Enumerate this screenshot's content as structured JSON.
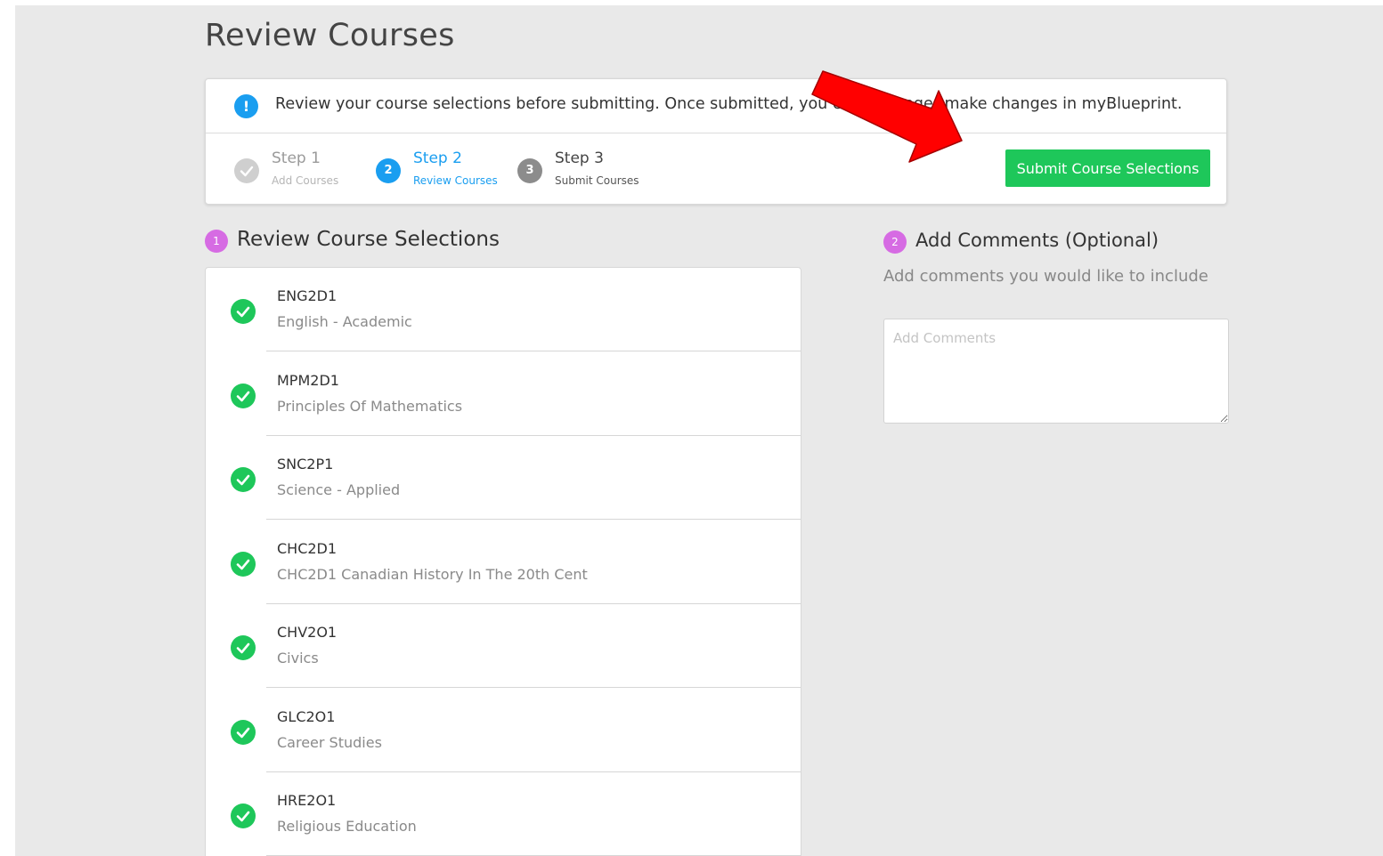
{
  "page": {
    "title": "Review Courses"
  },
  "notice": {
    "icon": "info-icon",
    "icon_glyph": "!",
    "text": "Review your course selections before submitting. Once submitted, you can no longer make changes in myBlueprint."
  },
  "steps": [
    {
      "title": "Step 1",
      "subtitle": "Add Courses",
      "state": "complete",
      "glyph": ""
    },
    {
      "title": "Step 2",
      "subtitle": "Review Courses",
      "state": "active",
      "glyph": "2"
    },
    {
      "title": "Step 3",
      "subtitle": "Submit Courses",
      "state": "pending",
      "glyph": "3"
    }
  ],
  "submit_button": {
    "label": "Submit Course Selections"
  },
  "review_section": {
    "number": "1",
    "heading": "Review Course Selections",
    "courses": [
      {
        "code": "ENG2D1",
        "name": "English - Academic"
      },
      {
        "code": "MPM2D1",
        "name": "Principles Of Mathematics"
      },
      {
        "code": "SNC2P1",
        "name": "Science - Applied"
      },
      {
        "code": "CHC2D1",
        "name": "CHC2D1 Canadian History In The 20th Cent"
      },
      {
        "code": "CHV2O1",
        "name": "Civics"
      },
      {
        "code": "GLC2O1",
        "name": "Career Studies"
      },
      {
        "code": "HRE2O1",
        "name": "Religious Education"
      }
    ]
  },
  "comments_section": {
    "number": "2",
    "heading": "Add Comments (Optional)",
    "subheading": "Add comments you would like to include",
    "placeholder": "Add Comments",
    "value": ""
  },
  "annotation": {
    "type": "red-arrow-icon",
    "color": "#ff0000"
  },
  "colors": {
    "accent_blue": "#1a9ef0",
    "success_green": "#1ec75a",
    "badge_purple": "#d66be3",
    "background": "#e9e9e9"
  }
}
